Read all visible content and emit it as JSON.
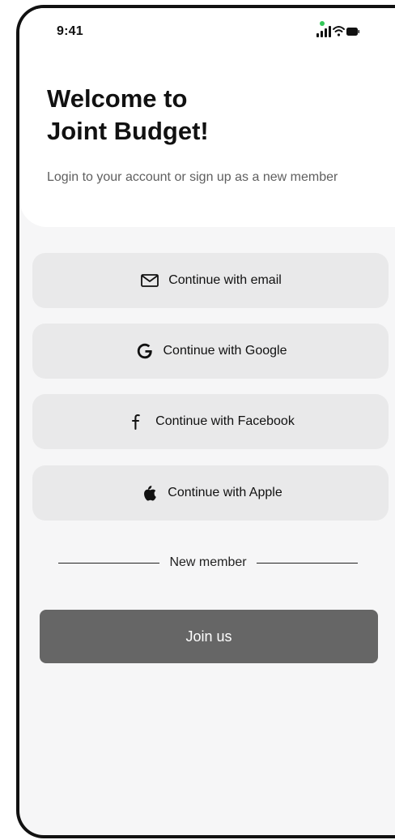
{
  "status_bar": {
    "time": "9:41",
    "icons": [
      "signal-icon",
      "wifi-icon",
      "battery-icon"
    ],
    "indicator_color": "#34c759"
  },
  "header": {
    "title_line1": "Welcome to",
    "title_line2": "Joint Budget!",
    "subtitle": "Login to your account or sign up as a new member"
  },
  "auth_buttons": [
    {
      "icon": "mail-icon",
      "label": "Continue with email"
    },
    {
      "icon": "google-icon",
      "label": "Continue with Google"
    },
    {
      "icon": "facebook-icon",
      "label": "Continue with Facebook"
    },
    {
      "icon": "apple-icon",
      "label": "Continue with Apple"
    }
  ],
  "divider": {
    "label": "New member"
  },
  "join": {
    "label": "Join us"
  },
  "colors": {
    "background": "#f6f6f7",
    "button_background": "#e9e9ea",
    "join_button": "#666666",
    "frame": "#111111"
  }
}
